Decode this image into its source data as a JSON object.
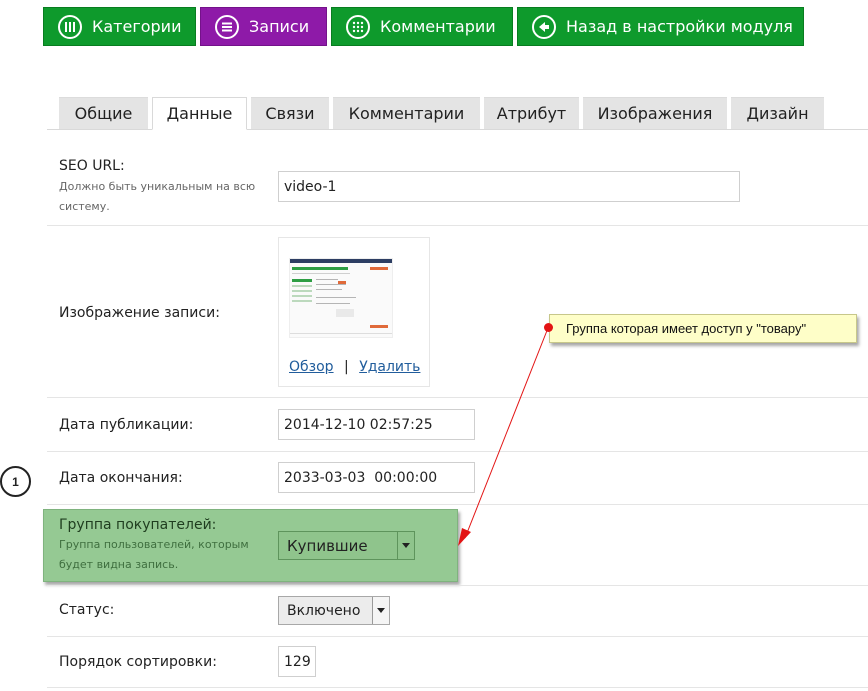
{
  "top_buttons": [
    {
      "label": "Категории",
      "icon": "grid-columns-icon",
      "active": false
    },
    {
      "label": "Записи",
      "icon": "list-lines-icon",
      "active": true
    },
    {
      "label": "Комментарии",
      "icon": "dots-grid-icon",
      "active": false
    },
    {
      "label": "Назад в настройки модуля",
      "icon": "arrow-left-icon",
      "active": false
    }
  ],
  "tabs": [
    {
      "label": "Общие",
      "active": false
    },
    {
      "label": "Данные",
      "active": true
    },
    {
      "label": "Связи",
      "active": false
    },
    {
      "label": "Комментарии",
      "active": false
    },
    {
      "label": "Атрибут",
      "active": false
    },
    {
      "label": "Изображения",
      "active": false
    },
    {
      "label": "Дизайн",
      "active": false
    }
  ],
  "form": {
    "seo_url": {
      "label": "SEO URL:",
      "help": "Должно быть уникальным на всю систему.",
      "value": "video-1"
    },
    "image": {
      "label": "Изображение записи:",
      "browse_link": "Обзор",
      "separator": "|",
      "delete_link": "Удалить"
    },
    "date_published": {
      "label": "Дата публикации:",
      "value": "2014-12-10 02:57:25"
    },
    "date_end": {
      "label": "Дата окончания:",
      "value": "2033-03-03  00:00:00"
    },
    "customer_group": {
      "label": "Группа покупателей:",
      "help": "Группа пользователей, которым будет видна запись.",
      "selected": "Купившие"
    },
    "status": {
      "label": "Статус:",
      "selected": "Включено"
    },
    "sort_order": {
      "label": "Порядок сортировки:",
      "value": "129"
    }
  },
  "annotation": {
    "tooltip_text": "Группа которая имеет доступ у \"товару\"",
    "step_number": "1"
  },
  "colors": {
    "module_button": "#0e9a2c",
    "module_button_active": "#8e1aa8",
    "highlight_box": "#95c993",
    "tooltip_bg": "#fefec8",
    "arrow": "#e31414",
    "link": "#215d9c"
  }
}
